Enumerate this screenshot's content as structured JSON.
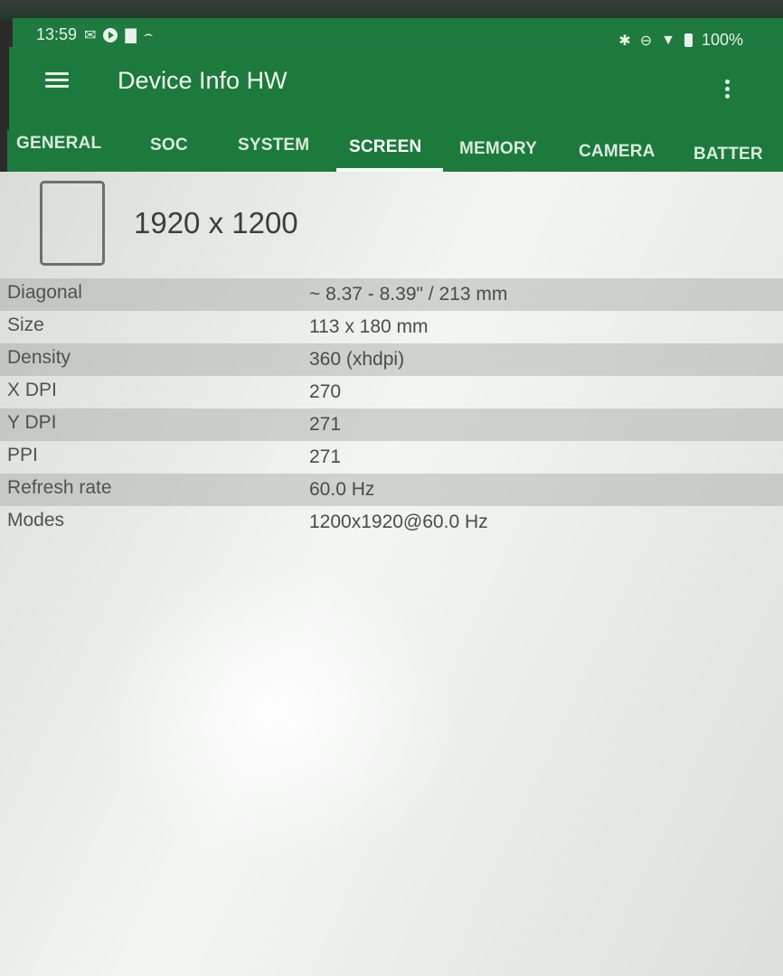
{
  "status_bar": {
    "time": "13:59",
    "battery": "100%",
    "icons": [
      "gmail-icon",
      "play-icon",
      "notification-icon",
      "line-icon",
      "bluetooth-icon",
      "do-not-disturb-icon",
      "wifi-icon",
      "battery-icon"
    ]
  },
  "toolbar": {
    "title": "Device Info HW"
  },
  "tabs": [
    {
      "label": "GENERAL"
    },
    {
      "label": "SOC"
    },
    {
      "label": "SYSTEM"
    },
    {
      "label": "SCREEN"
    },
    {
      "label": "MEMORY"
    },
    {
      "label": "CAMERA"
    },
    {
      "label": "BATTER"
    }
  ],
  "active_tab": "SCREEN",
  "screen": {
    "resolution": "1920 x 1200",
    "rows": [
      {
        "key": "Diagonal",
        "value": "~ 8.37 - 8.39\" / 213 mm"
      },
      {
        "key": "Size",
        "value": "113 x 180 mm"
      },
      {
        "key": "Density",
        "value": "360 (xhdpi)"
      },
      {
        "key": "X DPI",
        "value": "270"
      },
      {
        "key": "Y DPI",
        "value": "271"
      },
      {
        "key": "PPI",
        "value": "271"
      },
      {
        "key": "Refresh rate",
        "value": "60.0 Hz"
      },
      {
        "key": "Modes",
        "value": "1200x1920@60.0 Hz"
      }
    ]
  },
  "colors": {
    "toolbar": "#1c7a3c",
    "content_bg": "#e4e7e4"
  }
}
